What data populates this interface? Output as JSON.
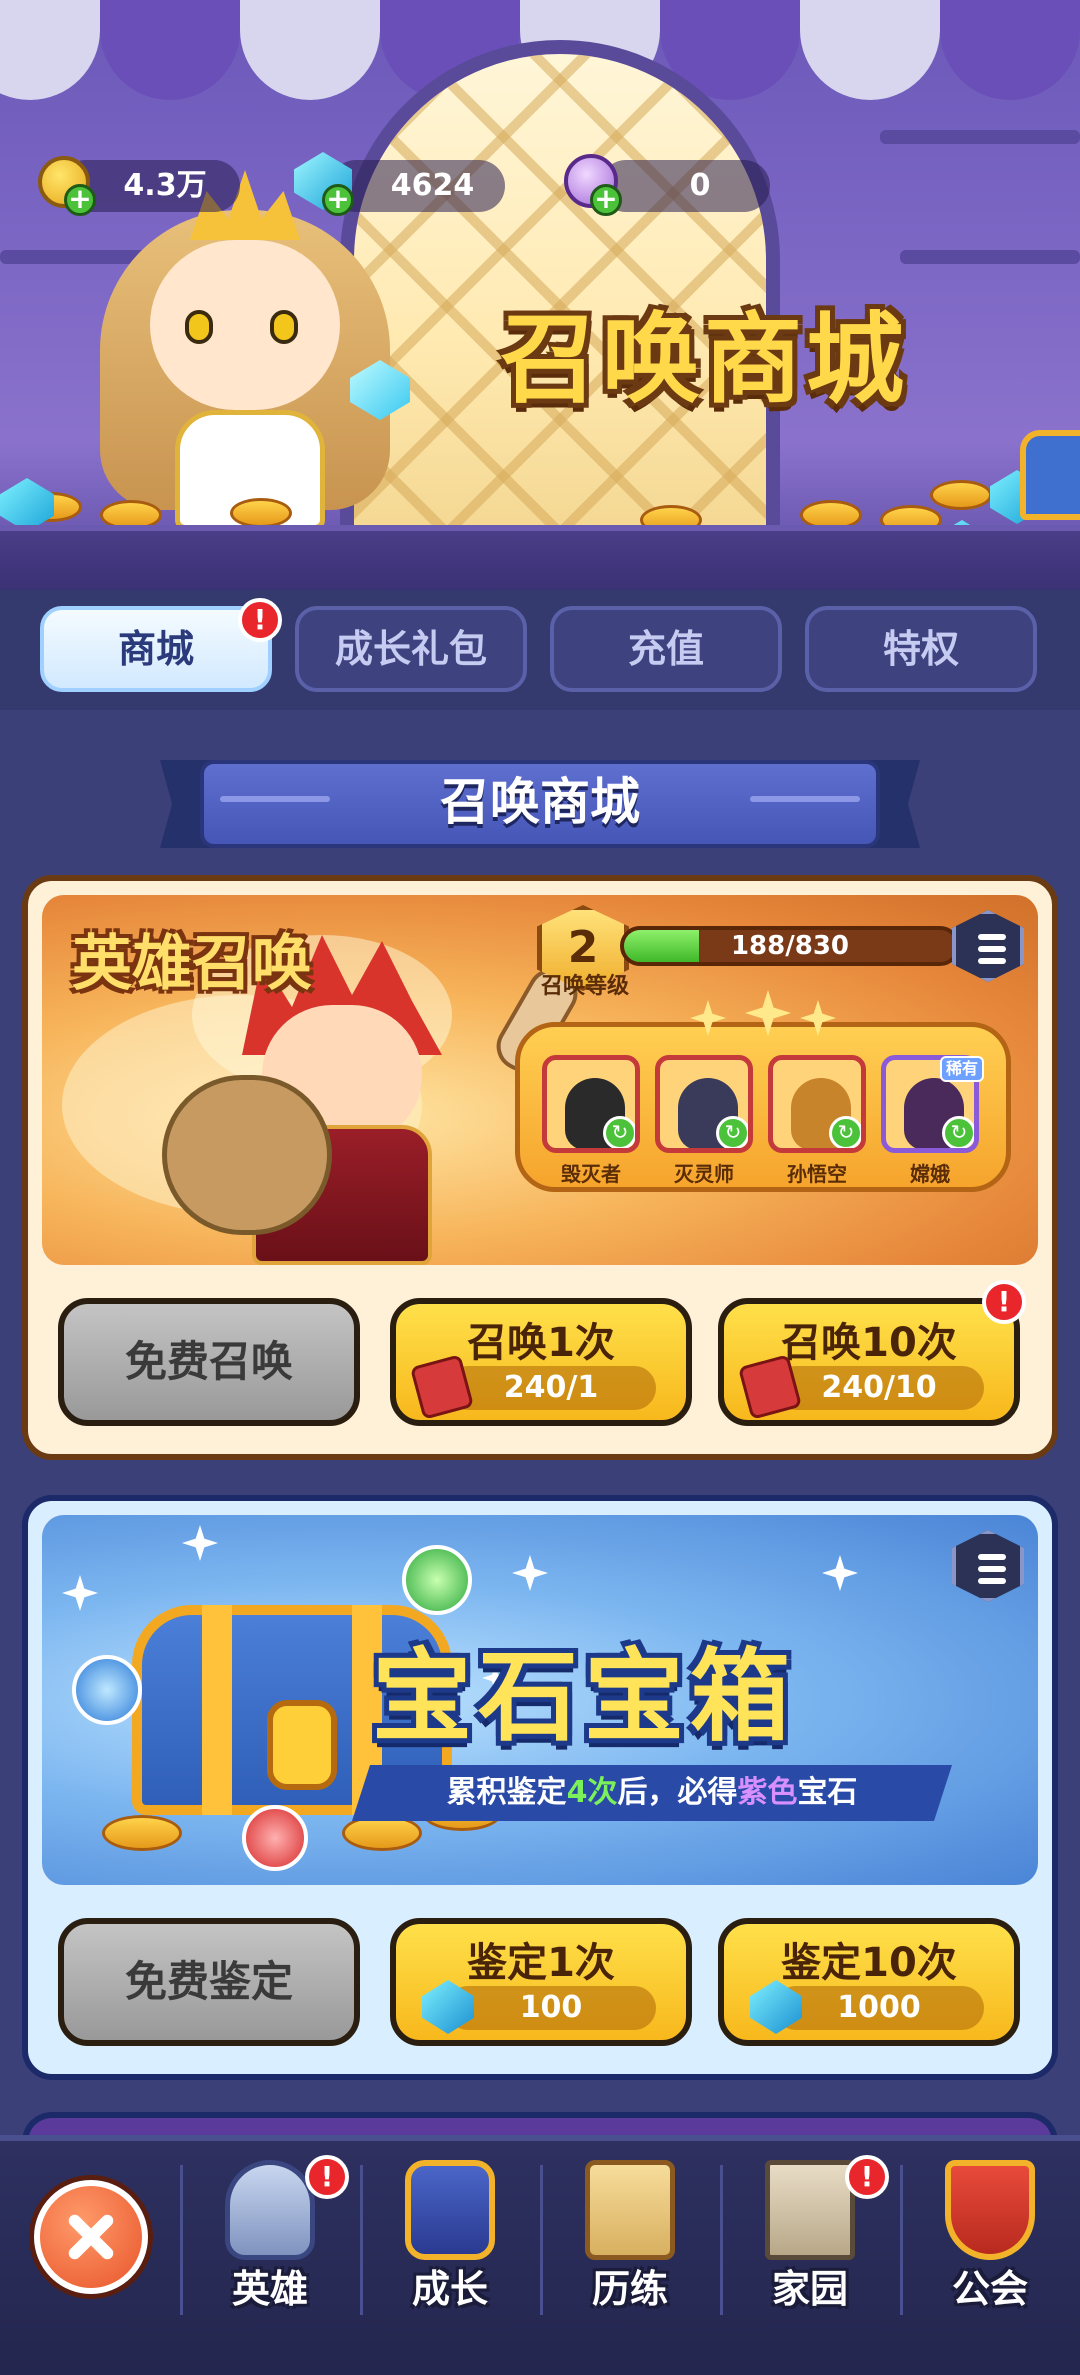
{
  "currencies": [
    {
      "name": "gold-coin",
      "value": "4.3万"
    },
    {
      "name": "diamond",
      "value": "4624"
    },
    {
      "name": "purple-crystal",
      "value": "0"
    }
  ],
  "banner": {
    "title": "召唤商城"
  },
  "tabs": [
    {
      "label": "商城",
      "active": true,
      "badge": "!"
    },
    {
      "label": "成长礼包",
      "active": false
    },
    {
      "label": "充值",
      "active": false
    },
    {
      "label": "特权",
      "active": false
    }
  ],
  "section_title": "召唤商城",
  "hero_summon": {
    "title": "英雄召唤",
    "level": "2",
    "level_label": "召唤等级",
    "xp_text": "188/830",
    "xp_fraction": 0.227,
    "heroes": [
      {
        "name": "毁灭者",
        "rarity_tag": ""
      },
      {
        "name": "灭灵师",
        "rarity_tag": ""
      },
      {
        "name": "孙悟空",
        "rarity_tag": ""
      },
      {
        "name": "嫦娥",
        "rarity_tag": "稀有"
      }
    ],
    "buttons": {
      "free_label": "免费召唤",
      "once_label": "召唤1次",
      "once_cost": "240/1",
      "ten_label": "召唤10次",
      "ten_cost": "240/10",
      "ten_badge": "!"
    }
  },
  "gem_chest": {
    "title": "宝石宝箱",
    "subtitle_pre": "累积鉴定",
    "subtitle_count": "4次",
    "subtitle_mid": "后，必得",
    "subtitle_color": "紫色",
    "subtitle_post": "宝石",
    "buttons": {
      "free_label": "免费鉴定",
      "once_label": "鉴定1次",
      "once_cost": "100",
      "ten_label": "鉴定10次",
      "ten_cost": "1000"
    }
  },
  "bottom_nav": [
    {
      "label": "英雄",
      "badge": "!",
      "icon": "knight-helmet-icon"
    },
    {
      "label": "成长",
      "badge": "",
      "icon": "growth-book-icon"
    },
    {
      "label": "历练",
      "badge": "",
      "icon": "scroll-map-icon"
    },
    {
      "label": "家园",
      "badge": "!",
      "icon": "castle-tower-icon"
    },
    {
      "label": "公会",
      "badge": "",
      "icon": "guild-banner-icon"
    }
  ],
  "colors": {
    "accent_gold": "#ffd94a",
    "badge_red": "#e8262b",
    "nav_bg": "#2e3160"
  }
}
